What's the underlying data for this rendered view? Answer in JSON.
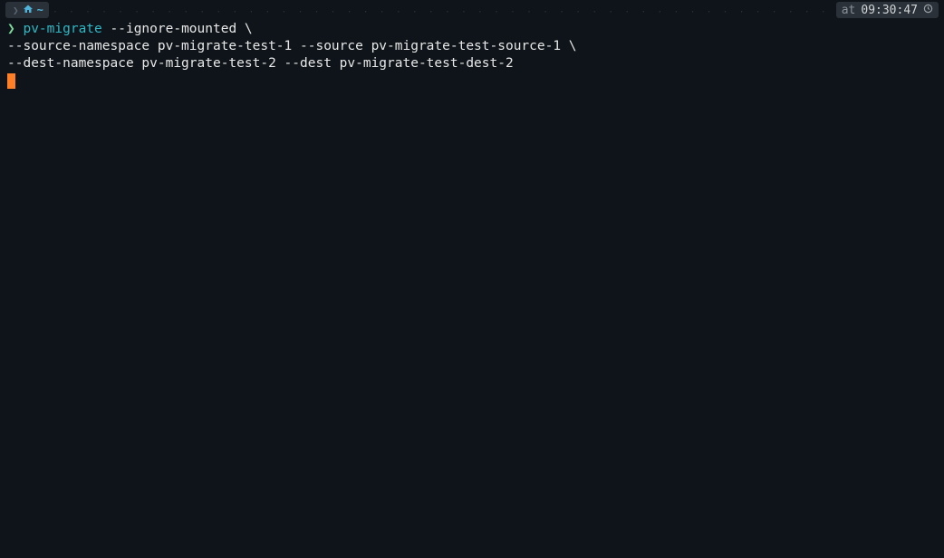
{
  "breadcrumb": {
    "os_icon": "apple-icon",
    "home_icon": "home-icon",
    "path": "~"
  },
  "status": {
    "at_label": "at",
    "time": "09:30:47",
    "clock_icon": "clock-icon"
  },
  "prompt": {
    "symbol": "❯",
    "command": "pv-migrate",
    "args_line1": " --ignore-mounted \\",
    "continuation_line2": "--source-namespace pv-migrate-test-1 --source pv-migrate-test-source-1 \\",
    "continuation_line3": "--dest-namespace pv-migrate-test-2 --dest pv-migrate-test-dest-2"
  },
  "dots": "· · · · · · · · · · · · · · · · · · · · · · · · · · · · · · · · · · · · · · · · · · · · · · · · · · · · · · · · · · · · · · · · · · · · · · · · · · · · · · · · · · · · · · · · · · · · · · · · · · · · · · · · · · · · · · · · · · · · · · · · · · · · · · · · · ·"
}
